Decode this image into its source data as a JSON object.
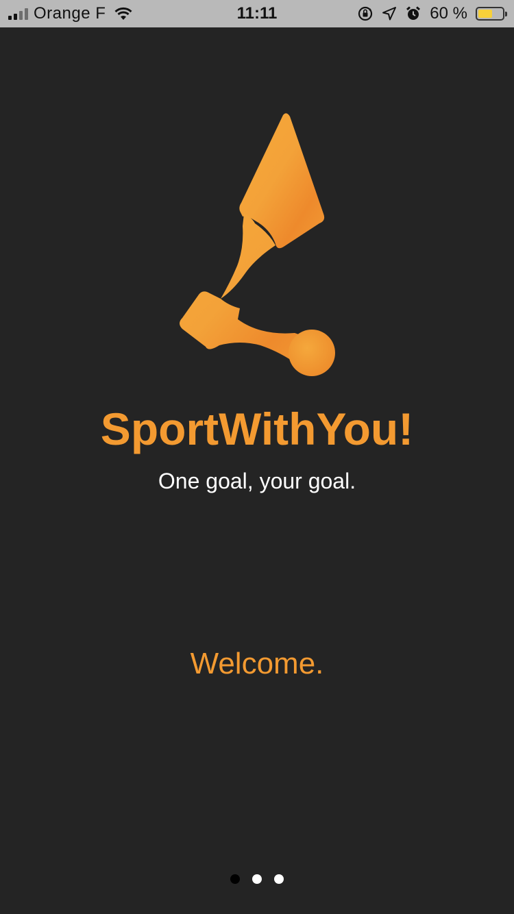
{
  "status_bar": {
    "carrier": "Orange F",
    "time": "11:11",
    "battery_text": "60 %",
    "battery_level": 0.6,
    "icons": [
      "signal-icon",
      "wifi-icon",
      "orientation-lock-icon",
      "location-arrow-icon",
      "alarm-icon",
      "battery-icon"
    ]
  },
  "splash": {
    "title": "SportWithYou!",
    "tagline": "One goal, your goal.",
    "welcome": "Welcome."
  },
  "pager": {
    "page_count": 3,
    "active_index": 0
  },
  "colors": {
    "background": "#242424",
    "accent": "#f39a31",
    "status_bar": "#b9b9b9",
    "battery_fill": "#f7d13a"
  }
}
